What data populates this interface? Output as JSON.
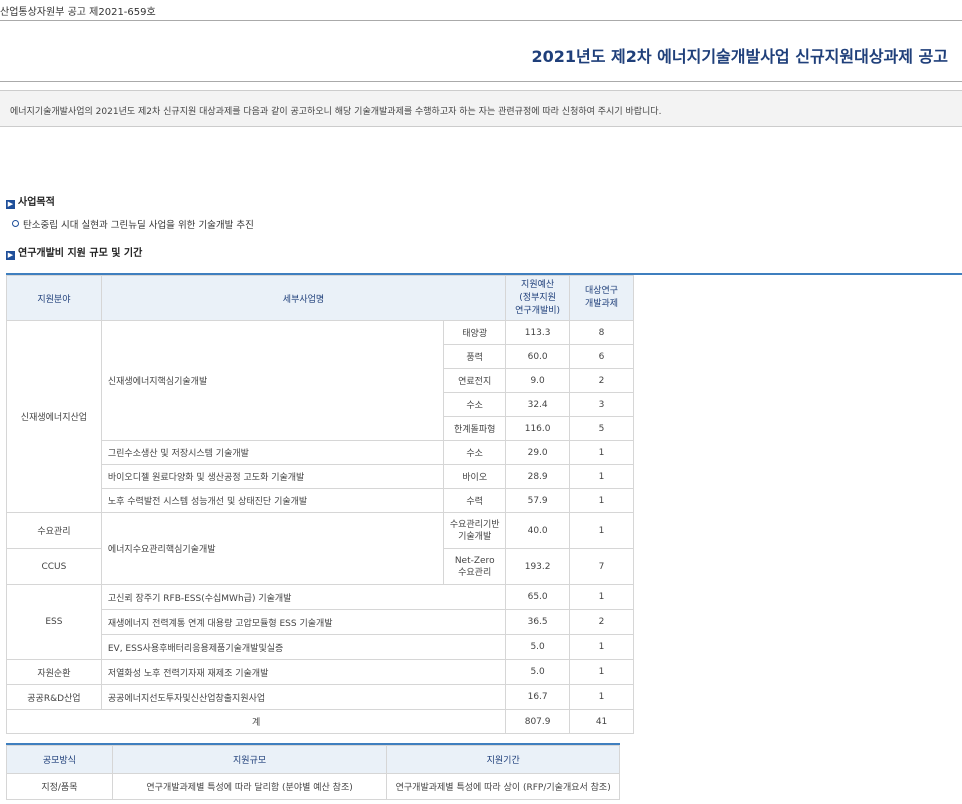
{
  "notice_number": "산업통상자원부 공고 제2021-659호",
  "title": "2021년도 제2차 에너지기술개발사업 신규지원대상과제 공고",
  "intro": "에너지기술개발사업의 2021년도 제2차 신규지원 대상과제를 다음과 같이 공고하오니 해당 기술개발과제를 수행하고자 하는 자는 관련규정에 따라 신청하여 주시기 바랍니다.",
  "section1": {
    "title": "사업목적",
    "bullet": "탄소중립 시대 실현과 그린뉴딜 사업을 위한 기술개발 추진"
  },
  "section2": {
    "title": "연구개발비 지원 규모 및 기간"
  },
  "table1": {
    "headers": {
      "field": "지원분야",
      "program": "세부사업명",
      "budget": "지원예산\n(정부지원\n연구개발비)",
      "count": "대상연구\n개발과제"
    },
    "fields": {
      "renewable": "신재생에너지산업",
      "demand": "수요관리",
      "ccus": "CCUS",
      "ess": "ESS",
      "resource": "자원순환",
      "public": "공공R&D산업"
    },
    "programs": {
      "p1": "신재생에너지핵심기술개발",
      "p2": "그린수소생산 및 저장시스템 기술개발",
      "p3": "바이오디젤 원료다양화 및 생산공정 고도화 기술개발",
      "p4": "노후 수력발전 시스템 성능개선 및 상태진단 기술개발",
      "p5": "에너지수요관리핵심기술개발",
      "p6": "고신뢰 장주기 RFB-ESS(수십MWh급) 기술개발",
      "p7": "재생에너지 전력계통 연계 대용량 고압모듈형 ESS 기술개발",
      "p8": "EV, ESS사용후배터리응용제품기술개발및실증",
      "p9": "저열화성 노후 전력기자재 재제조 기술개발",
      "p10": "공공에너지선도투자및신산업창출지원사업"
    },
    "rows": [
      {
        "sub": "태양광",
        "budget": "113.3",
        "count": "8"
      },
      {
        "sub": "풍력",
        "budget": "60.0",
        "count": "6"
      },
      {
        "sub": "연료전지",
        "budget": "9.0",
        "count": "2"
      },
      {
        "sub": "수소",
        "budget": "32.4",
        "count": "3"
      },
      {
        "sub": "한계돌파형",
        "budget": "116.0",
        "count": "5"
      },
      {
        "sub": "수소",
        "budget": "29.0",
        "count": "1"
      },
      {
        "sub": "바이오",
        "budget": "28.9",
        "count": "1"
      },
      {
        "sub": "수력",
        "budget": "57.9",
        "count": "1"
      },
      {
        "sub": "수요관리기반\n기술개발",
        "budget": "40.0",
        "count": "1"
      },
      {
        "sub": "Net-Zero\n수요관리",
        "budget": "193.2",
        "count": "7"
      },
      {
        "sub": "",
        "budget": "65.0",
        "count": "1"
      },
      {
        "sub": "",
        "budget": "36.5",
        "count": "2"
      },
      {
        "sub": "",
        "budget": "5.0",
        "count": "1"
      },
      {
        "sub": "",
        "budget": "5.0",
        "count": "1"
      },
      {
        "sub": "",
        "budget": "16.7",
        "count": "1"
      }
    ],
    "total": {
      "label": "계",
      "budget": "807.9",
      "count": "41"
    }
  },
  "table2": {
    "headers": {
      "method": "공모방식",
      "scale": "지원규모",
      "period": "지원기간"
    },
    "row": {
      "method": "지정/품목",
      "scale": "연구개발과제별 특성에 따라 달리함 (분야별 예산 참조)",
      "period": "연구개발과제별 특성에 따라 상이 (RFP/기술개요서 참조)"
    }
  }
}
